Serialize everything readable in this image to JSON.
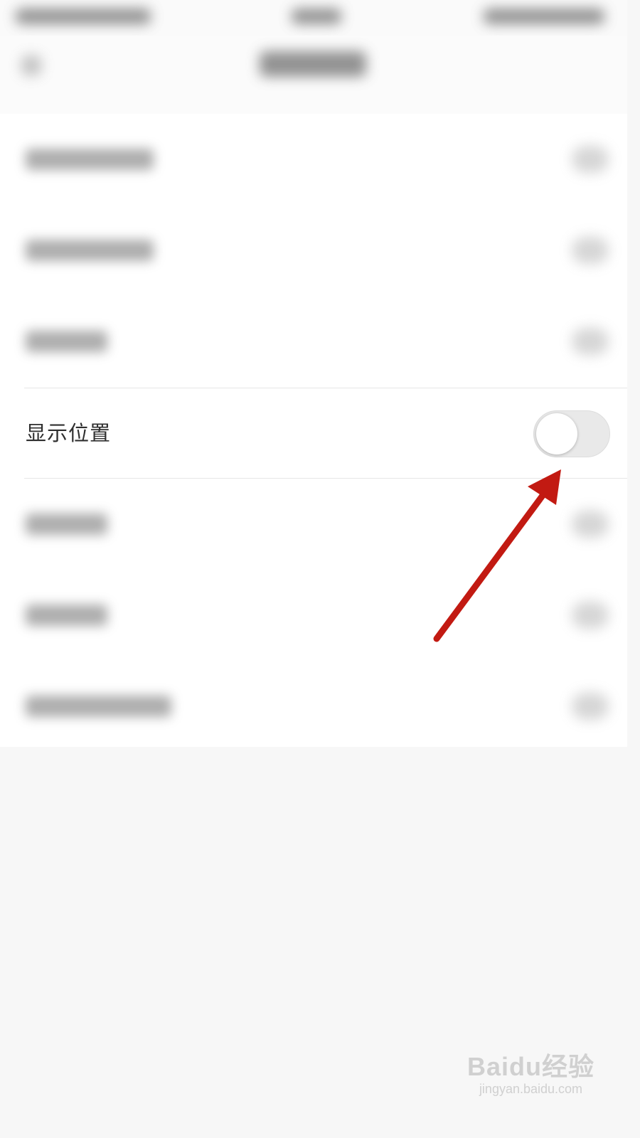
{
  "settings": {
    "show_location": {
      "label": "显示位置",
      "toggle_state": "off"
    }
  },
  "annotation": {
    "arrow_color": "#c21a12"
  },
  "watermark": {
    "brand": "Baidu经验",
    "url": "jingyan.baidu.com"
  }
}
